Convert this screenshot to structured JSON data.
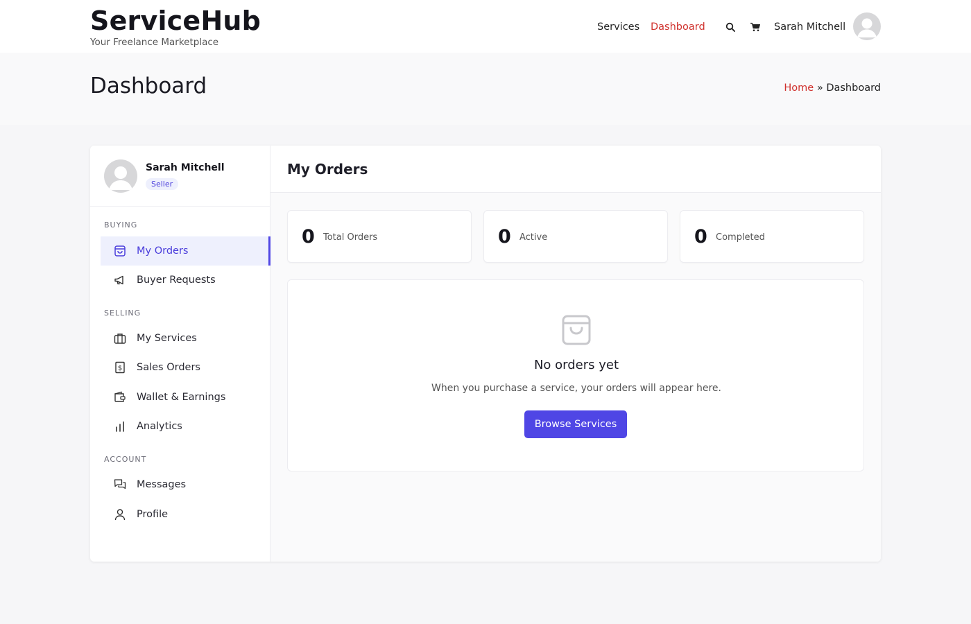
{
  "brand": {
    "title": "ServiceHub",
    "tagline": "Your Freelance Marketplace"
  },
  "header": {
    "nav": [
      {
        "label": "Services"
      },
      {
        "label": "Dashboard",
        "active": true
      }
    ],
    "icons": [
      "search-icon",
      "cart-icon"
    ],
    "user_name": "Sarah Mitchell"
  },
  "page": {
    "title": "Dashboard",
    "breadcrumb": {
      "home": "Home",
      "separator": "»",
      "current": "Dashboard"
    }
  },
  "sidebar": {
    "profile": {
      "name": "Sarah Mitchell",
      "role": "Seller"
    },
    "sections": [
      {
        "label": "BUYING",
        "items": [
          {
            "label": "My Orders",
            "icon": "shopping-bag-icon",
            "active": true
          },
          {
            "label": "Buyer Requests",
            "icon": "megaphone-icon"
          }
        ]
      },
      {
        "label": "SELLING",
        "items": [
          {
            "label": "My Services",
            "icon": "briefcase-icon"
          },
          {
            "label": "Sales Orders",
            "icon": "receipt-icon"
          },
          {
            "label": "Wallet & Earnings",
            "icon": "wallet-icon"
          },
          {
            "label": "Analytics",
            "icon": "bar-chart-icon"
          }
        ]
      },
      {
        "label": "ACCOUNT",
        "items": [
          {
            "label": "Messages",
            "icon": "chat-icon"
          },
          {
            "label": "Profile",
            "icon": "user-icon"
          }
        ]
      }
    ]
  },
  "content": {
    "title": "My Orders",
    "stats": [
      {
        "value": "0",
        "label": "Total Orders"
      },
      {
        "value": "0",
        "label": "Active"
      },
      {
        "value": "0",
        "label": "Completed"
      }
    ],
    "empty": {
      "icon": "shopping-bag-icon",
      "title": "No orders yet",
      "text": "When you purchase a service, your orders will appear here.",
      "button_label": "Browse Services"
    }
  },
  "colors": {
    "accent": "#4f46e5",
    "link_red": "#d0312d",
    "active_bg": "#eef0fd"
  }
}
